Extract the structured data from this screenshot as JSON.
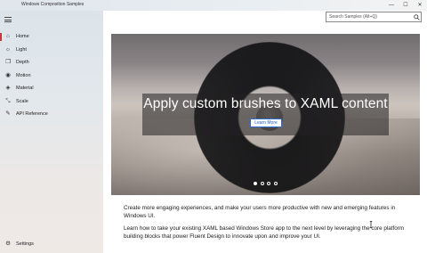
{
  "window": {
    "title": "Windows Composition Samples",
    "controls": [
      {
        "name": "minimize",
        "glyph": "—"
      },
      {
        "name": "maximize",
        "glyph": "☐"
      },
      {
        "name": "close",
        "glyph": "✕"
      }
    ]
  },
  "sidebar": {
    "items": [
      {
        "label": "Home",
        "icon": "home-icon",
        "glyph": "⌂",
        "active": true
      },
      {
        "label": "Light",
        "icon": "light-icon",
        "glyph": "☼",
        "active": false
      },
      {
        "label": "Depth",
        "icon": "depth-icon",
        "glyph": "❒",
        "active": false
      },
      {
        "label": "Motion",
        "icon": "motion-icon",
        "glyph": "◉",
        "active": false
      },
      {
        "label": "Material",
        "icon": "material-icon",
        "glyph": "◈",
        "active": false
      },
      {
        "label": "Scale",
        "icon": "scale-icon",
        "glyph": "⤡",
        "active": false
      },
      {
        "label": "API Reference",
        "icon": "api-reference-icon",
        "glyph": "✎",
        "active": false
      }
    ],
    "settings": {
      "label": "Settings",
      "icon": "gear-icon",
      "glyph": "⚙"
    }
  },
  "search": {
    "placeholder": "Search Samples (Alt+Q)",
    "value": ""
  },
  "hero": {
    "title": "Apply custom brushes to XAML content",
    "button_label": "Learn More",
    "slides": 4,
    "active_slide": 0
  },
  "content": {
    "paragraph1": "Create more engaging experiences, and make your users more productive with new and emerging features in Windows UI.",
    "paragraph2": "Learn how to take your existing XAML based Windows Store app to the next level by leveraging the core platform building blocks that power Fluent Design to innovate upon and improve your UI."
  },
  "colors": {
    "accent": "#d13438",
    "link": "#1f5fbf"
  }
}
